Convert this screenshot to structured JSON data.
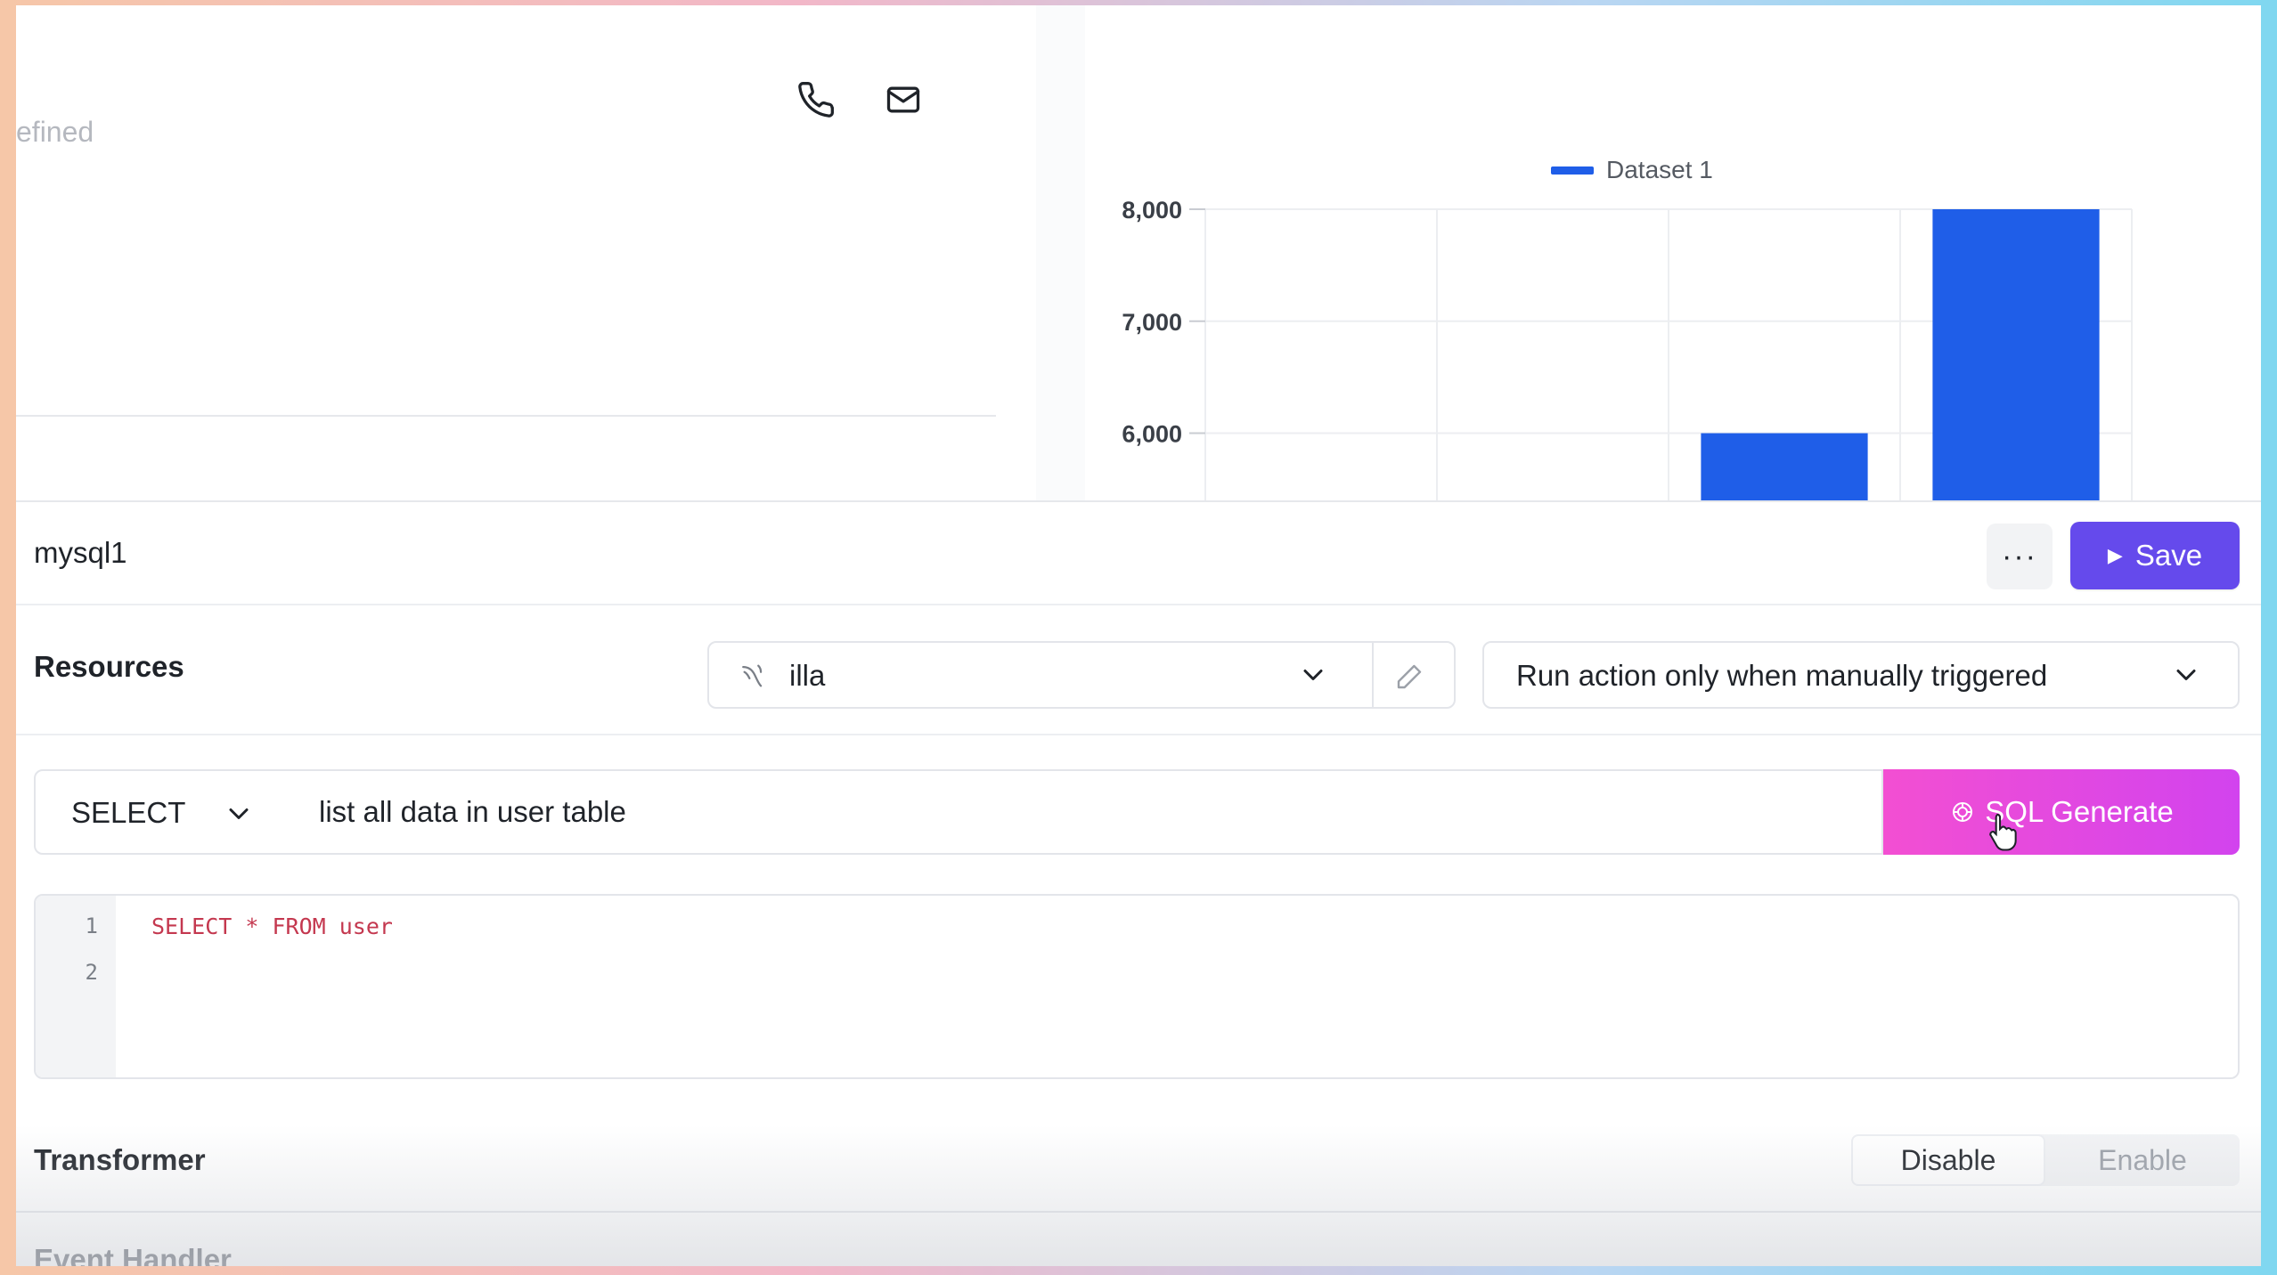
{
  "canvas": {
    "left_card": {
      "partial_text": "efined"
    },
    "chart_data": {
      "type": "bar",
      "legend": [
        "Dataset 1"
      ],
      "series": [
        {
          "name": "Dataset 1",
          "values": [
            null,
            null,
            6000,
            8000
          ]
        }
      ],
      "y_ticks": [
        "8,000",
        "7,000",
        "6,000"
      ],
      "ylim": [
        5400,
        8000
      ],
      "grid": true,
      "legend_position": "top",
      "bar_color": "#1f5ee8"
    }
  },
  "action": {
    "name": "mysql1",
    "more_label": "···",
    "save_label": "Save"
  },
  "resources": {
    "label": "Resources",
    "selected": "illa",
    "trigger_mode": "Run action only when manually triggered"
  },
  "query": {
    "sql_type": "SELECT",
    "prompt_value": "list all data in user table",
    "generate_label": "SQL Generate"
  },
  "editor": {
    "lines": [
      {
        "no": "1",
        "code": "SELECT * FROM user"
      },
      {
        "no": "2",
        "code": ""
      }
    ]
  },
  "transformer": {
    "label": "Transformer",
    "options": [
      "Disable",
      "Enable"
    ],
    "selected": "Disable"
  },
  "event_handler": {
    "label": "Event Handler"
  },
  "colors": {
    "accent": "#654aec",
    "generate_gradient_start": "#f34fd2",
    "generate_gradient_end": "#d243ee",
    "sql_keyword": "#c4384f"
  }
}
